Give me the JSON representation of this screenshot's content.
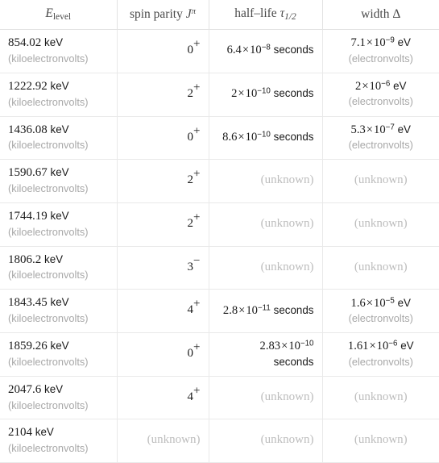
{
  "table": {
    "columns": [
      {
        "key": "energy",
        "label_base": "E",
        "label_sub": "level",
        "align": "left"
      },
      {
        "key": "spin",
        "label_base": "spin parity",
        "label_sym": "J",
        "label_sup": "π",
        "align": "right"
      },
      {
        "key": "half",
        "label_base": "half–life",
        "label_sym": "τ",
        "label_sub_frac": "1/2",
        "align": "right"
      },
      {
        "key": "width",
        "label_base": "width",
        "label_sym": "Δ",
        "align": "center"
      }
    ],
    "unknown_text": "(unknown)",
    "energy_unit": "keV",
    "energy_unit_note": "(kiloelectronvolts)",
    "width_unit": "eV",
    "width_unit_note": "(electronvolts)",
    "half_unit": "seconds",
    "rows": [
      {
        "energy_value": "854.02",
        "spin_number": "0",
        "spin_parity": "+",
        "half_mantissa": "6.4",
        "half_exponent": "−8",
        "half_known": true,
        "width_mantissa": "7.1",
        "width_exponent": "−9",
        "width_known": true
      },
      {
        "energy_value": "1222.92",
        "spin_number": "2",
        "spin_parity": "+",
        "half_mantissa": "2",
        "half_exponent": "−10",
        "half_known": true,
        "width_mantissa": "2",
        "width_exponent": "−6",
        "width_known": true
      },
      {
        "energy_value": "1436.08",
        "spin_number": "0",
        "spin_parity": "+",
        "half_mantissa": "8.6",
        "half_exponent": "−10",
        "half_known": true,
        "width_mantissa": "5.3",
        "width_exponent": "−7",
        "width_known": true
      },
      {
        "energy_value": "1590.67",
        "spin_number": "2",
        "spin_parity": "+",
        "half_known": false,
        "width_known": false
      },
      {
        "energy_value": "1744.19",
        "spin_number": "2",
        "spin_parity": "+",
        "half_known": false,
        "width_known": false
      },
      {
        "energy_value": "1806.2",
        "spin_number": "3",
        "spin_parity": "−",
        "half_known": false,
        "width_known": false
      },
      {
        "energy_value": "1843.45",
        "spin_number": "4",
        "spin_parity": "+",
        "half_mantissa": "2.8",
        "half_exponent": "−11",
        "half_known": true,
        "width_mantissa": "1.6",
        "width_exponent": "−5",
        "width_known": true
      },
      {
        "energy_value": "1859.26",
        "spin_number": "0",
        "spin_parity": "+",
        "half_mantissa": "2.83",
        "half_exponent": "−10",
        "half_known": true,
        "width_mantissa": "1.61",
        "width_exponent": "−6",
        "width_known": true
      },
      {
        "energy_value": "2047.6",
        "spin_number": "4",
        "spin_parity": "+",
        "half_known": false,
        "width_known": false
      },
      {
        "energy_value": "2104",
        "spin_known": false,
        "half_known": false,
        "width_known": false
      }
    ]
  },
  "colors": {
    "text": "#1a1a1a",
    "muted": "#a8a8a8",
    "unknown": "#bdbdbd",
    "header": "#4a4a4a",
    "border": "#e9e9e9",
    "header_border": "#e2e2e2",
    "background": "#ffffff"
  }
}
